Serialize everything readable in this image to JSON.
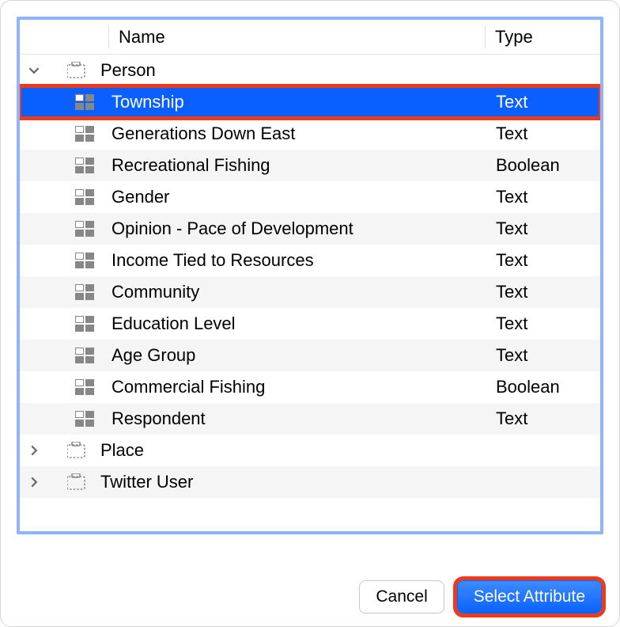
{
  "headers": {
    "name": "Name",
    "type": "Type"
  },
  "categories": [
    {
      "name": "Person",
      "expanded": true,
      "attributes": [
        {
          "name": "Township",
          "type": "Text",
          "selected": true,
          "highlighted": true
        },
        {
          "name": "Generations Down East",
          "type": "Text"
        },
        {
          "name": "Recreational Fishing",
          "type": "Boolean"
        },
        {
          "name": "Gender",
          "type": "Text"
        },
        {
          "name": "Opinion - Pace of Development",
          "type": "Text"
        },
        {
          "name": "Income Tied to Resources",
          "type": "Text"
        },
        {
          "name": "Community",
          "type": "Text"
        },
        {
          "name": "Education Level",
          "type": "Text"
        },
        {
          "name": "Age Group",
          "type": "Text"
        },
        {
          "name": "Commercial Fishing",
          "type": "Boolean"
        },
        {
          "name": "Respondent",
          "type": "Text"
        }
      ]
    },
    {
      "name": "Place",
      "expanded": false,
      "attributes": []
    },
    {
      "name": "Twitter User",
      "expanded": false,
      "attributes": []
    }
  ],
  "buttons": {
    "cancel": "Cancel",
    "select": "Select Attribute"
  }
}
